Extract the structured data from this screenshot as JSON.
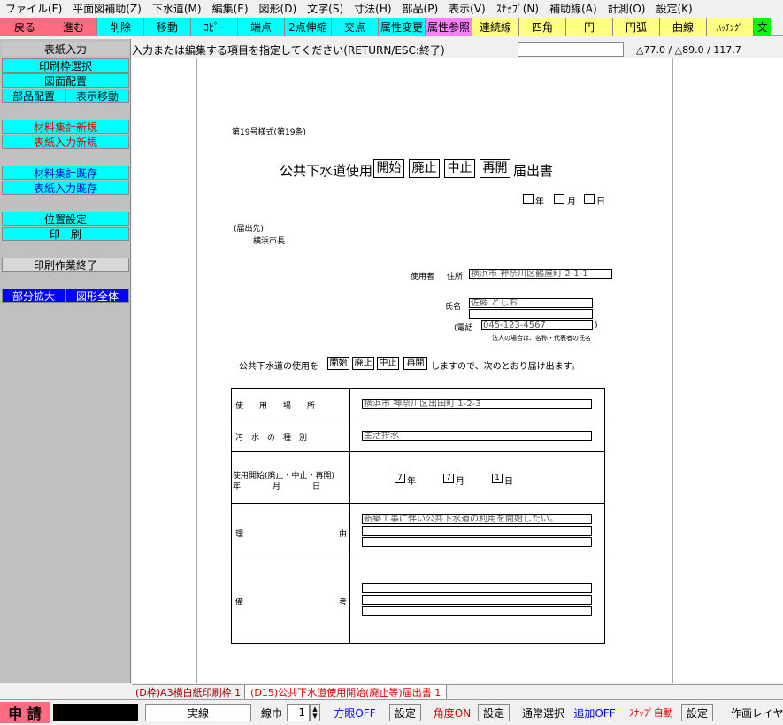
{
  "menu": [
    "ファイル(F)",
    "平面図補助(Z)",
    "下水道(M)",
    "編集(E)",
    "図形(D)",
    "文字(S)",
    "寸法(H)",
    "部品(P)",
    "表示(V)",
    "ｽﾅｯﾌﾟ(N)",
    "補助線(A)",
    "計測(O)",
    "設定(K)"
  ],
  "toolbar": [
    "戻る",
    "進む",
    "削除",
    "移動",
    "ｺﾋﾟｰ",
    "端点",
    "2点伸縮",
    "交点",
    "属性変更",
    "属性参照",
    "連続線",
    "四角",
    "円",
    "円弧",
    "曲線",
    "ﾊｯﾁﾝｸﾞ",
    "文"
  ],
  "left": {
    "title": "表紙入力",
    "print_frame": "印刷枠選択",
    "drawing_layout": "図面配置",
    "parts_layout": "部品配置",
    "display_move": "表示移動",
    "material_new": "材料集計新規",
    "cover_new": "表紙入力新規",
    "material_existing": "材料集計既存",
    "cover_existing": "表紙入力既存",
    "position": "位置設定",
    "print": "印　刷",
    "print_end": "印刷作業終了",
    "zoom_part": "部分拡大",
    "zoom_all": "図形全体"
  },
  "prompt": {
    "text": "入力または編集する項目を指定してください(RETURN/ESC:終了)",
    "input": "",
    "coords": "△77.0 / △89.0 / 117.7"
  },
  "doc": {
    "form_no": "第19号様式(第19条)",
    "title_pre": "公共下水道使用",
    "opt1": "開始",
    "opt2": "廃止",
    "opt3": "中止",
    "opt4": "再開",
    "title_post": "届出書",
    "year": "年",
    "month": "月",
    "day": "日",
    "to_label": "(届出先)",
    "to_name": "横浜市長",
    "user_label": "使用者",
    "addr_label": "住所",
    "addr_value": "横浜市 神奈川区鶴屋町 2-1-1",
    "name_label": "氏名",
    "name_value": "佐藤 としお",
    "tel_label": "(電話",
    "tel_value": "045-123-4567",
    "tel_close": ")",
    "corp_note": "法人の場合は、名称・代表者の氏名",
    "body_pre": "公共下水道の使用を",
    "body_post": "しますので、次のとおり届け出ます。",
    "row1_label": "使　　用　　場　　所",
    "row1_value": "横浜市 神奈川区出田町 1-2-3",
    "row2_label": "汚　水　の　種　別",
    "row2_value": "生活排水",
    "row3_label1": "使用開始(廃止・中止・再開)",
    "row3_label2": "年　　　　月　　　　日",
    "row3_y": "7",
    "row3_m": "7",
    "row3_d": "1",
    "row4_label_a": "理",
    "row4_label_b": "由",
    "row4_value": "新築工事に伴い公共下水道の利用を開始したい。",
    "row5_label_a": "備",
    "row5_label_b": "考"
  },
  "tabs": {
    "tab1": "(D枠)A3横白紙印刷枠 1",
    "tab2": "(D15)公共下水道使用開始(廃止等)届出書 1"
  },
  "status": {
    "mode": "申 請",
    "linetype": "実線",
    "linewidth_label": "線巾",
    "linewidth_value": "1",
    "grid": "方眼OFF",
    "set1": "設定",
    "angle": "角度ON",
    "set2": "設定",
    "select": "通常選択",
    "add": "追加OFF",
    "snap": "ｽﾅｯﾌﾟ自動",
    "set3": "設定",
    "layer": "作画レイヤ"
  },
  "colors": {
    "pink": "#ff6b80",
    "cyan": "#00ffff",
    "yellow": "#ffff80",
    "magenta": "#ff80ff",
    "green": "#00ff00",
    "blue": "#0000ff",
    "red": "#e00000"
  }
}
